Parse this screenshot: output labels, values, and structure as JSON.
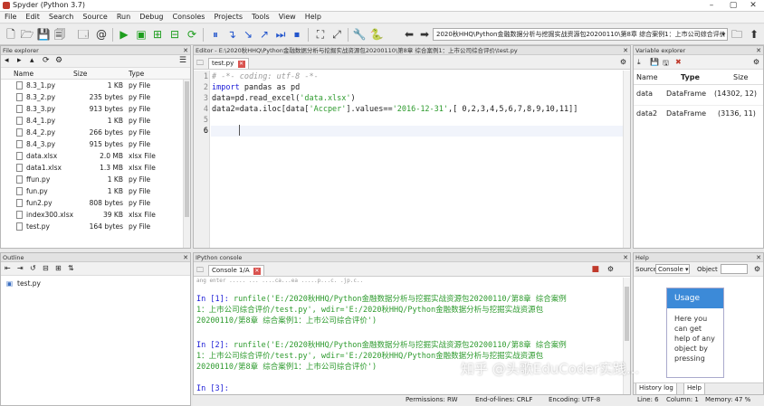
{
  "window": {
    "title": "Spyder (Python 3.7)"
  },
  "menu": [
    "File",
    "Edit",
    "Search",
    "Source",
    "Run",
    "Debug",
    "Consoles",
    "Projects",
    "Tools",
    "View",
    "Help"
  ],
  "toolbar": {
    "path": "2020秋HHQ\\Python金融数据分析与挖掘实战资源包20200110\\第8章 综合案例1：上市公司综合评价"
  },
  "file_explorer": {
    "title": "File explorer",
    "columns": {
      "name": "Name",
      "size": "Size",
      "type": "Type"
    },
    "files": [
      {
        "name": "8.3_1.py",
        "size": "1 KB",
        "type": "py File"
      },
      {
        "name": "8.3_2.py",
        "size": "235 bytes",
        "type": "py File"
      },
      {
        "name": "8.3_3.py",
        "size": "913 bytes",
        "type": "py File"
      },
      {
        "name": "8.4_1.py",
        "size": "1 KB",
        "type": "py File"
      },
      {
        "name": "8.4_2.py",
        "size": "266 bytes",
        "type": "py File"
      },
      {
        "name": "8.4_3.py",
        "size": "915 bytes",
        "type": "py File"
      },
      {
        "name": "data.xlsx",
        "size": "2.0 MB",
        "type": "xlsx File"
      },
      {
        "name": "data1.xlsx",
        "size": "1.3 MB",
        "type": "xlsx File"
      },
      {
        "name": "ffun.py",
        "size": "1 KB",
        "type": "py File"
      },
      {
        "name": "fun.py",
        "size": "1 KB",
        "type": "py File"
      },
      {
        "name": "fun2.py",
        "size": "808 bytes",
        "type": "py File"
      },
      {
        "name": "index300.xlsx",
        "size": "39 KB",
        "type": "xlsx File"
      },
      {
        "name": "test.py",
        "size": "164 bytes",
        "type": "py File"
      }
    ]
  },
  "outline": {
    "title": "Outline",
    "item": "test.py"
  },
  "editor": {
    "title": "Editor - E:\\2020秋HHQ\\Python金融数据分析与挖掘实战资源包20200110\\第8章 综合案例1：上市公司综合评价\\test.py",
    "tab": "test.py",
    "line_numbers": [
      "1",
      "2",
      "3",
      "4",
      "5",
      "6"
    ],
    "lines": {
      "l1": "# -*- coding: utf-8 -*-",
      "l2_kw": "import",
      "l2_rest": " pandas as pd",
      "l3_a": "data=pd.read_excel(",
      "l3_s": "'data.xlsx'",
      "l3_b": ")",
      "l4_a": "data2=data.iloc[data[",
      "l4_s1": "'Accper'",
      "l4_b": "].values==",
      "l4_s2": "'2016-12-31'",
      "l4_c": ",[ 0,2,3,4,5,6,7,8,9,10,11]]"
    }
  },
  "variable_explorer": {
    "title": "Variable explorer",
    "columns": {
      "name": "Name",
      "type": "Type",
      "size": "Size"
    },
    "rows": [
      {
        "name": "data",
        "type": "DataFrame",
        "size": "(14302, 12)"
      },
      {
        "name": "data2",
        "type": "DataFrame",
        "size": "(3136, 11)"
      }
    ]
  },
  "console": {
    "title": "IPython console",
    "tab": "Console 1/A",
    "partial_top": "ang enter ..... ... ....ca...ea .....p...c. .jp.c..",
    "in1_prompt": "In [1]:",
    "in1_l1": "runfile('E:/2020秋HHQ/Python金融数据分析与挖掘实战资源包20200110/第8章 综合案例",
    "in1_l2": "1：上市公司综合评价/test.py', wdir='E:/2020秋HHQ/Python金融数据分析与挖掘实战资源包",
    "in1_l3": "20200110/第8章 综合案例1：上市公司综合评价')",
    "in2_prompt": "In [2]:",
    "in2_l1": "runfile('E:/2020秋HHQ/Python金融数据分析与挖掘实战资源包20200110/第8章 综合案例",
    "in2_l2": "1：上市公司综合评价/test.py', wdir='E:/2020秋HHQ/Python金融数据分析与挖掘实战资源包",
    "in2_l3": "20200110/第8章 综合案例1：上市公司综合评价')",
    "in3_prompt": "In [3]:"
  },
  "help": {
    "title": "Help",
    "source_label": "Source",
    "source_value": "Console",
    "object_label": "Object",
    "usage_title": "Usage",
    "usage_text": "Here you can get help of any object by pressing",
    "tab_history": "History log",
    "tab_help": "Help"
  },
  "watermark": "知乎 @头歌EduCoder实践...",
  "status": {
    "permissions": "Permissions: RW",
    "eol": "End-of-lines: CRLF",
    "encoding": "Encoding: UTF-8",
    "line": "Line: 6",
    "column": "Column: 1",
    "memory": "Memory: 47 %"
  }
}
